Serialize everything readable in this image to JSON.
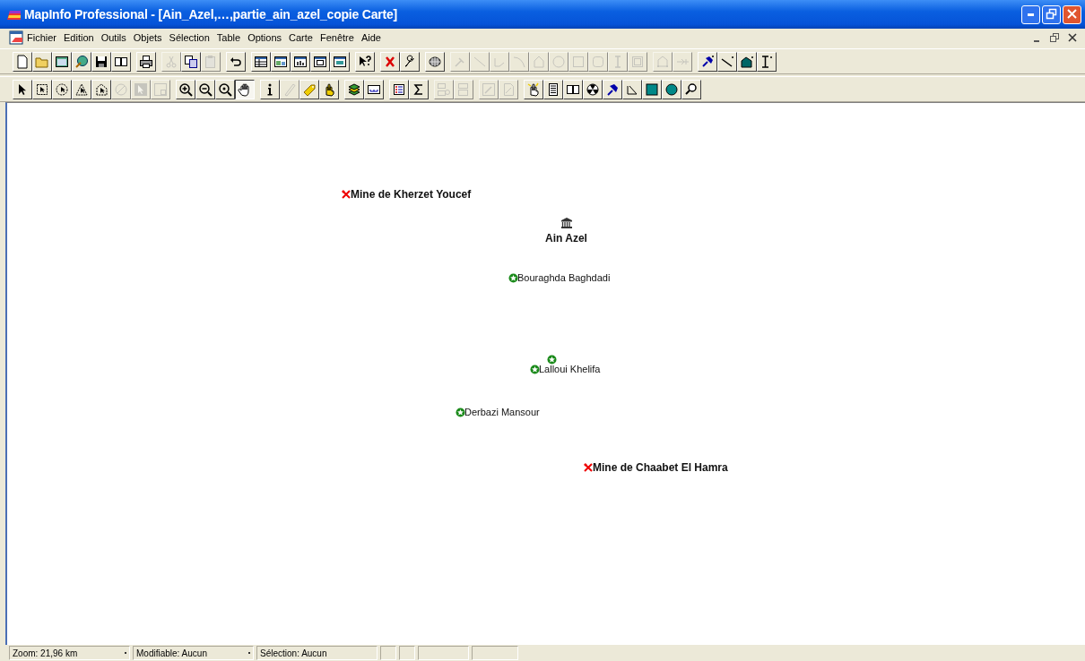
{
  "window": {
    "title": "MapInfo Professional - [Ain_Azel,…,partie_ain_azel_copie Carte]"
  },
  "menu": [
    "Fichier",
    "Edition",
    "Outils",
    "Objets",
    "Sélection",
    "Table",
    "Options",
    "Carte",
    "Fenêtre",
    "Aide"
  ],
  "toolbars": [
    {
      "groups": [
        {
          "buttons": [
            {
              "kind": "new",
              "disabled": false,
              "pressed": false
            },
            {
              "kind": "open",
              "disabled": false,
              "pressed": false
            },
            {
              "kind": "workspace",
              "disabled": false,
              "pressed": false
            },
            {
              "kind": "dbms",
              "disabled": false,
              "pressed": false
            },
            {
              "kind": "save",
              "disabled": false,
              "pressed": false
            },
            {
              "kind": "book",
              "disabled": false,
              "pressed": false
            }
          ]
        },
        {
          "buttons": [
            {
              "kind": "print",
              "disabled": false,
              "pressed": false
            }
          ]
        },
        {
          "buttons": [
            {
              "kind": "cut",
              "disabled": true,
              "pressed": false
            },
            {
              "kind": "copy",
              "disabled": false,
              "pressed": false
            },
            {
              "kind": "paste",
              "disabled": true,
              "pressed": false
            }
          ]
        },
        {
          "buttons": [
            {
              "kind": "undo",
              "disabled": false,
              "pressed": false
            }
          ]
        },
        {
          "buttons": [
            {
              "kind": "browser",
              "disabled": false,
              "pressed": false
            },
            {
              "kind": "mapwin",
              "disabled": false,
              "pressed": false
            },
            {
              "kind": "graph",
              "disabled": false,
              "pressed": false
            },
            {
              "kind": "layout",
              "disabled": false,
              "pressed": false
            },
            {
              "kind": "redistrict",
              "disabled": false,
              "pressed": false
            }
          ]
        },
        {
          "buttons": [
            {
              "kind": "help",
              "disabled": false,
              "pressed": false
            }
          ]
        },
        {
          "buttons": [
            {
              "kind": "run",
              "disabled": false,
              "pressed": false
            },
            {
              "kind": "wrench",
              "disabled": false,
              "pressed": false
            }
          ]
        },
        {
          "buttons": [
            {
              "kind": "sphere",
              "disabled": false,
              "pressed": false
            }
          ]
        },
        {
          "buttons": [
            {
              "kind": "symbol",
              "disabled": true,
              "pressed": false
            },
            {
              "kind": "line",
              "disabled": true,
              "pressed": false
            },
            {
              "kind": "polyline",
              "disabled": true,
              "pressed": false
            },
            {
              "kind": "arc",
              "disabled": true,
              "pressed": false
            },
            {
              "kind": "polygon",
              "disabled": true,
              "pressed": false
            },
            {
              "kind": "ellipse",
              "disabled": true,
              "pressed": false
            },
            {
              "kind": "rect",
              "disabled": true,
              "pressed": false
            },
            {
              "kind": "roundrect",
              "disabled": true,
              "pressed": false
            },
            {
              "kind": "text",
              "disabled": true,
              "pressed": false
            },
            {
              "kind": "frame",
              "disabled": true,
              "pressed": false
            }
          ]
        },
        {
          "buttons": [
            {
              "kind": "reshape",
              "disabled": true,
              "pressed": false
            },
            {
              "kind": "addnode",
              "disabled": true,
              "pressed": false
            }
          ]
        },
        {
          "buttons": [
            {
              "kind": "pinq",
              "disabled": false,
              "pressed": false
            },
            {
              "kind": "lineq",
              "disabled": false,
              "pressed": false
            },
            {
              "kind": "polyq",
              "disabled": false,
              "pressed": false
            },
            {
              "kind": "textq",
              "disabled": false,
              "pressed": false
            }
          ]
        }
      ]
    },
    {
      "groups": [
        {
          "buttons": [
            {
              "kind": "select",
              "disabled": false,
              "pressed": false
            },
            {
              "kind": "marquee",
              "disabled": false,
              "pressed": false
            },
            {
              "kind": "radius",
              "disabled": false,
              "pressed": false
            },
            {
              "kind": "polyselect",
              "disabled": false,
              "pressed": false
            },
            {
              "kind": "boundary",
              "disabled": false,
              "pressed": false
            },
            {
              "kind": "invert",
              "disabled": true,
              "pressed": false
            },
            {
              "kind": "graphsel",
              "disabled": true,
              "pressed": false
            },
            {
              "kind": "layoutsel",
              "disabled": true,
              "pressed": false
            }
          ]
        },
        {
          "buttons": [
            {
              "kind": "zoomin",
              "disabled": false,
              "pressed": false
            },
            {
              "kind": "zoomout",
              "disabled": false,
              "pressed": false
            },
            {
              "kind": "changeview",
              "disabled": false,
              "pressed": false
            },
            {
              "kind": "hand",
              "disabled": false,
              "pressed": true
            }
          ]
        },
        {
          "buttons": [
            {
              "kind": "info",
              "disabled": false,
              "pressed": false
            },
            {
              "kind": "ruler",
              "disabled": true,
              "pressed": false
            },
            {
              "kind": "label",
              "disabled": false,
              "pressed": false
            },
            {
              "kind": "drag",
              "disabled": false,
              "pressed": false
            }
          ]
        },
        {
          "buttons": [
            {
              "kind": "layers",
              "disabled": false,
              "pressed": false
            },
            {
              "kind": "scale",
              "disabled": false,
              "pressed": false
            }
          ]
        },
        {
          "buttons": [
            {
              "kind": "legend",
              "disabled": false,
              "pressed": false
            },
            {
              "kind": "sigma",
              "disabled": false,
              "pressed": false
            }
          ]
        },
        {
          "buttons": [
            {
              "kind": "split",
              "disabled": true,
              "pressed": false
            },
            {
              "kind": "merge",
              "disabled": true,
              "pressed": false
            }
          ]
        },
        {
          "buttons": [
            {
              "kind": "redisA",
              "disabled": true,
              "pressed": false
            },
            {
              "kind": "redisB",
              "disabled": true,
              "pressed": false
            }
          ]
        },
        {
          "buttons": [
            {
              "kind": "hotlink",
              "disabled": false,
              "pressed": false
            },
            {
              "kind": "document",
              "disabled": false,
              "pressed": false
            },
            {
              "kind": "book",
              "disabled": false,
              "pressed": false
            },
            {
              "kind": "radial",
              "disabled": false,
              "pressed": false
            },
            {
              "kind": "pin",
              "disabled": false,
              "pressed": false
            },
            {
              "kind": "polyline2",
              "disabled": false,
              "pressed": false
            },
            {
              "kind": "square",
              "disabled": false,
              "pressed": false
            },
            {
              "kind": "circle",
              "disabled": false,
              "pressed": false
            },
            {
              "kind": "magnifier",
              "disabled": false,
              "pressed": false
            }
          ]
        }
      ]
    }
  ],
  "map": {
    "points": [
      {
        "kind": "mine",
        "label": "Mine de Kherzet Youcef"
      },
      {
        "kind": "town",
        "label": "Ain Azel"
      },
      {
        "kind": "farm",
        "label": "Bouraghda Baghdadi"
      },
      {
        "kind": "farm"
      },
      {
        "kind": "farm",
        "label": "Lalloui Khelifa"
      },
      {
        "kind": "farm",
        "label": "Derbazi Mansour"
      },
      {
        "kind": "mine",
        "label": "Mine de Chaabet El Hamra"
      }
    ]
  },
  "status_bar": {
    "fields": [
      "Zoom: 21,96 km",
      "Modifiable: Aucun",
      "Sélection: Aucun"
    ]
  }
}
